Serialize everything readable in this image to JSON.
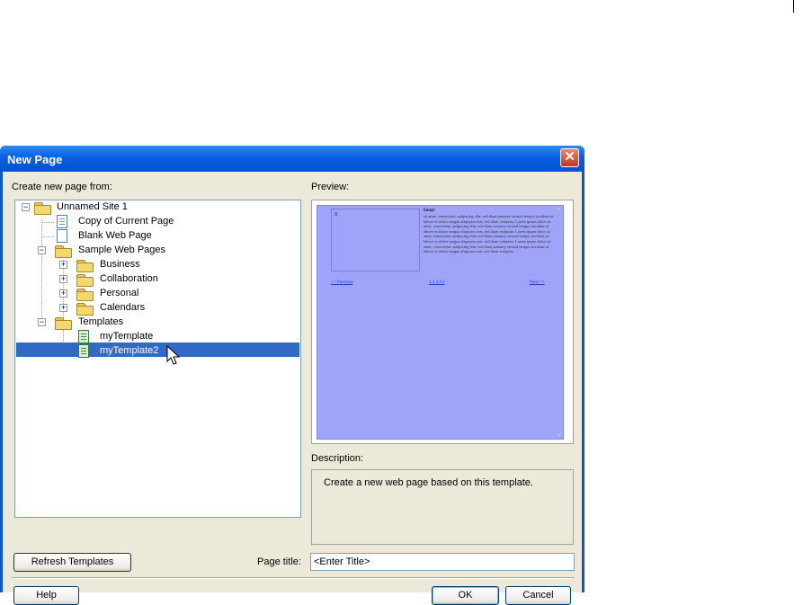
{
  "dialog": {
    "title": "New Page",
    "close_glyph": "✕",
    "create_label": "Create new page from:",
    "preview_label": "Preview:",
    "description_label": "Description:",
    "description_text": "Create a new web page based on this template.",
    "page_title_label": "Page title:",
    "page_title_value": "<Enter Title>",
    "buttons": {
      "refresh": "Refresh Templates",
      "help": "Help",
      "ok": "OK",
      "cancel": "Cancel"
    }
  },
  "tree": {
    "items": [
      {
        "label": "Unnamed Site 1",
        "icon": "folder-open-icon",
        "expander": "−"
      },
      {
        "label": "Copy of Current Page",
        "icon": "page-copy-icon"
      },
      {
        "label": "Blank Web Page",
        "icon": "blank-page-icon"
      },
      {
        "label": "Sample Web Pages",
        "icon": "folder-open-icon",
        "expander": "−"
      },
      {
        "label": "Business",
        "icon": "folder-icon",
        "expander": "+"
      },
      {
        "label": "Collaboration",
        "icon": "folder-icon",
        "expander": "+"
      },
      {
        "label": "Personal",
        "icon": "folder-icon",
        "expander": "+"
      },
      {
        "label": "Calendars",
        "icon": "folder-icon",
        "expander": "+"
      },
      {
        "label": "Templates",
        "icon": "folder-open-icon",
        "expander": "−"
      },
      {
        "label": "myTemplate",
        "icon": "template-icon"
      },
      {
        "label": "myTemplate2",
        "icon": "template-icon",
        "selected": true
      }
    ]
  },
  "preview": {
    "image_placeholder": "x",
    "heading": "Gray!",
    "body_text": "sit amet, consectetur sadipscing elitr, sed diam nonumy eirmod tempor invidunt ut labore et dolore magna aliquyam erat, sed diam voluptua. Lorem ipsum dolor sit amet, consectetur sadipscing elitr, sed diam nonumy eirmod tempor invidunt ut labore et dolore magna aliquyam erat, sed diam voluptua. Lorem ipsum dolor sit amet, consectetur sadipscing elitr, sed diam nonumy eirmod tempor invidunt ut labore et dolore magna aliquyam erat, sed diam voluptua. Lorem ipsum dolor sit amet, consectetur sadipscing elitr, sed diam nonumy eirmod tempor invidunt ut labore et dolore magna aliquyam erat, sed diam voluptua.",
    "prev_link": "<< Previous",
    "pages_link": "1 2 3 4 5",
    "next_link": "Next >>"
  },
  "colors": {
    "title_bar": "#0a5ee0",
    "selection": "#316ac5",
    "preview_bg": "#9fa4f8",
    "dialog_face": "#ece9d8"
  }
}
